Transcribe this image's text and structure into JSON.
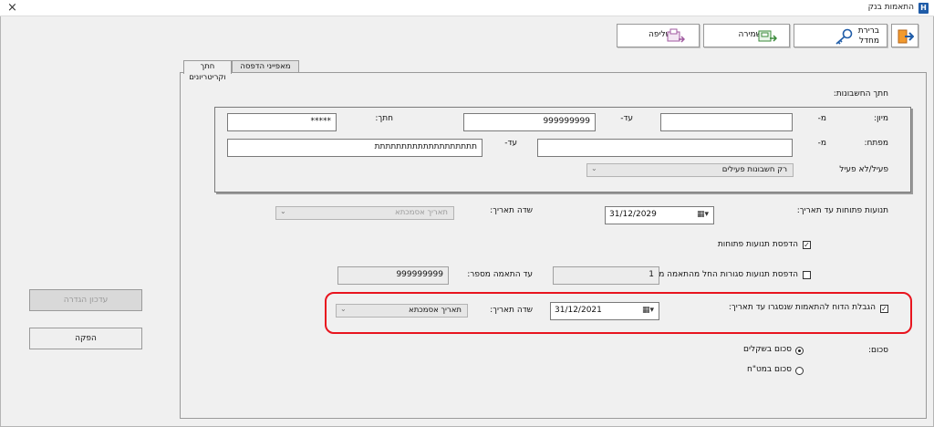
{
  "window": {
    "title": "התאמות בנק"
  },
  "toolbar": {
    "exit_label": "",
    "default_label_line1": "ברירת",
    "default_label_line2": "מחדל",
    "save_label": "שמירה",
    "retrieve_label": "שליפה"
  },
  "tabs": [
    {
      "label": "חתך וקריטריונים",
      "active": true
    },
    {
      "label": "מאפייני הדפסה",
      "active": false
    }
  ],
  "section_title": "חתך החשבונות:",
  "accounts": {
    "sort_label": "מיון:",
    "from_label": "מ-",
    "from_sort_value": "",
    "to_label": "עד-",
    "to_sort_value": "999999999",
    "cut_label": "חתך:",
    "cut_value": "*****",
    "key_label": "מפתח:",
    "from_key_label": "מ-",
    "from_key_value": "",
    "to_key_label": "עד-",
    "to_key_value": "תתתתתתתתתתתתתתתתתתת",
    "active_label": "פעיל/לא פעיל",
    "active_value": "רק חשבונות פעילים"
  },
  "open_moves": {
    "label": "תנועות פתוחות עד תאריך:",
    "date": "31/12/2029",
    "date_field_label": "שדה תאריך:",
    "date_field_value": "תאריך אסמכתא"
  },
  "print_open": {
    "label": "הדפסת תנועות פתוחות",
    "checked": true
  },
  "print_closed": {
    "label": "הדפסת תנועות סגורות החל מהתאמה מספר:",
    "checked": false,
    "from_value": "1",
    "to_label": "עד התאמה מספר:",
    "to_value": "999999999"
  },
  "limit_report": {
    "label": "הגבלת הדוח להתאמות שנסגרו עד תאריך:",
    "checked": true,
    "date": "31/12/2021",
    "date_field_label": "שדה תאריך:",
    "date_field_value": "תאריך אסמכתא"
  },
  "sum": {
    "label": "סכום:",
    "options": [
      {
        "label": "סכום בשקלים",
        "selected": true
      },
      {
        "label": "סכום במט\"ח",
        "selected": false
      }
    ]
  },
  "side_buttons": {
    "update_label": "עדכון הגדרה",
    "produce_label": "הפקה"
  },
  "colors": {
    "highlight": "#e8141e",
    "accent": "#1f5ca8"
  }
}
